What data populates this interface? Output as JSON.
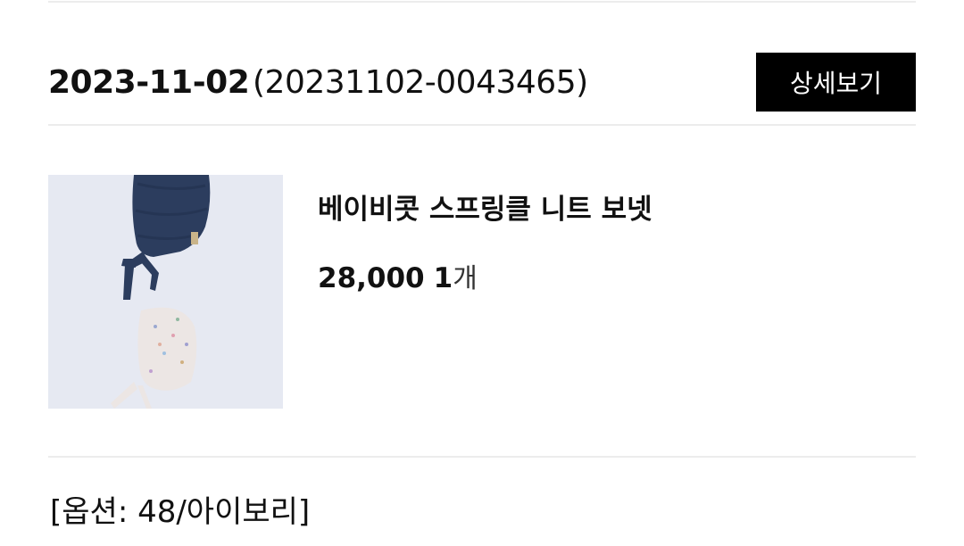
{
  "order": {
    "date": "2023-11-02",
    "number": "(20231102-0043465)",
    "detail_button": "상세보기"
  },
  "product": {
    "name": "베이비콧 스프링클 니트 보넷",
    "price": "28,000",
    "quantity": "1",
    "quantity_unit": "개",
    "image_icon": "knit-bonnet-product-image"
  },
  "option": {
    "text": "[옵션: 48/아이보리]"
  },
  "colors": {
    "button_bg": "#000000",
    "button_text": "#ffffff",
    "divider": "#ececec",
    "thumb_bg": "#e6e9f2",
    "navy_bonnet": "#2c3d5e",
    "ivory_bonnet": "#ece6e4"
  }
}
